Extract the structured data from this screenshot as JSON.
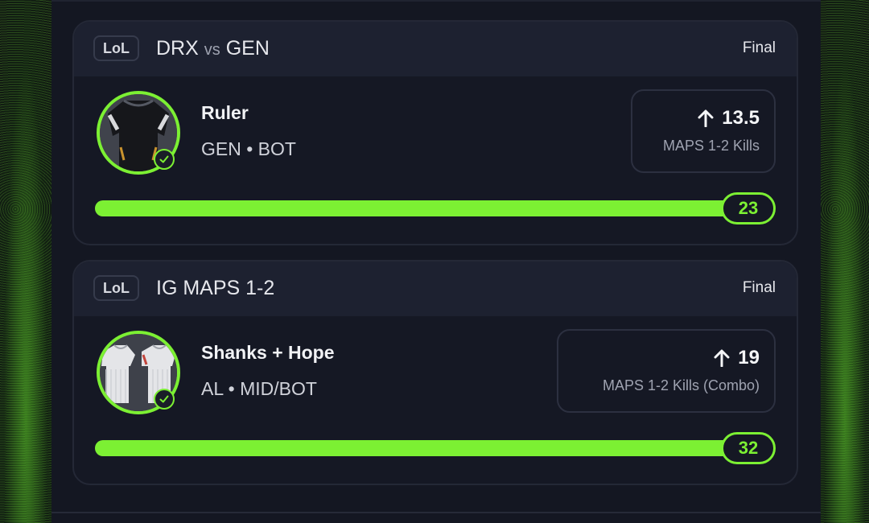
{
  "colors": {
    "accent": "#7cf033",
    "panel": "#141722",
    "card_header": "#1d2130"
  },
  "cards": [
    {
      "game_tag": "LoL",
      "matchup_left": "DRX",
      "matchup_vs": "vs",
      "matchup_right": "GEN",
      "status": "Final",
      "player_name": "Ruler",
      "player_team": "GEN • BOT",
      "direction_icon": "arrow-up-icon",
      "line_value": "13.5",
      "line_stat": "MAPS 1-2 Kills",
      "result": "23",
      "progress_fraction": 1.0
    },
    {
      "game_tag": "LoL",
      "matchup_title": "IG MAPS 1-2",
      "status": "Final",
      "player_name": "Shanks + Hope",
      "player_team": "AL • MID/BOT",
      "direction_icon": "arrow-up-icon",
      "line_value": "19",
      "line_stat": "MAPS 1-2 Kills (Combo)",
      "result": "32",
      "progress_fraction": 1.0
    }
  ]
}
